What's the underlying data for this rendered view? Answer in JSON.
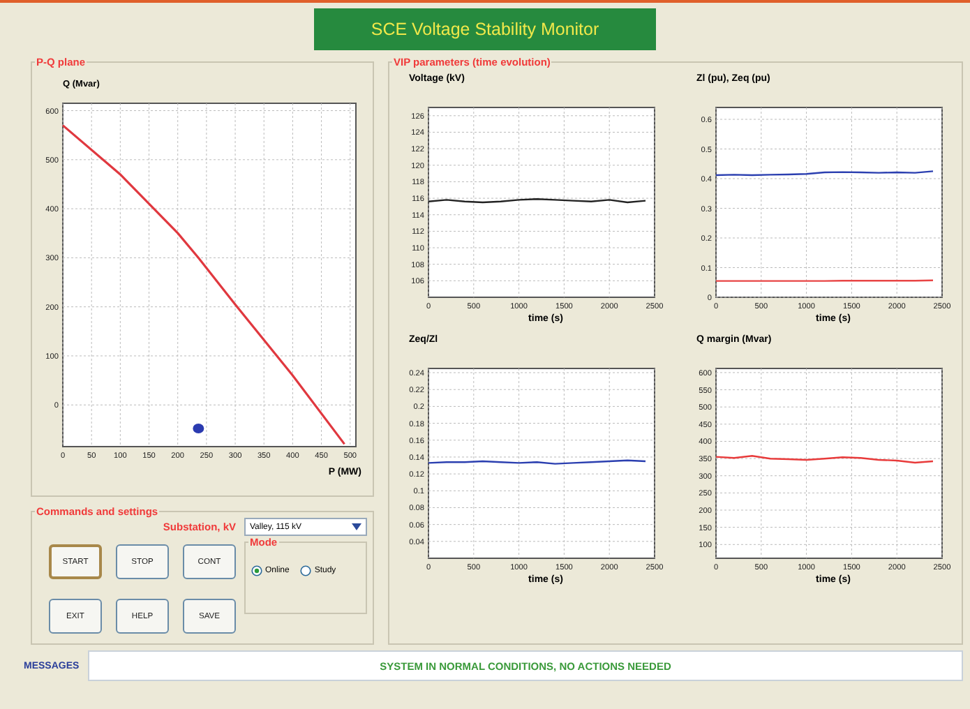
{
  "window": {
    "title": "SCE Voltage Stability Monitor"
  },
  "pq_panel": {
    "title": "P-Q plane",
    "chart_data": {
      "type": "line",
      "grid": true,
      "ylabel": "Q (Mvar)",
      "xlabel": "P (MW)",
      "x": [
        0,
        100,
        200,
        236,
        300,
        400,
        490
      ],
      "xlim": [
        0,
        510
      ],
      "ylim": [
        -85,
        615
      ],
      "xticks": [
        0,
        50,
        100,
        150,
        200,
        250,
        300,
        350,
        400,
        450,
        500
      ],
      "yticks": [
        0,
        100,
        200,
        300,
        400,
        500,
        600
      ],
      "series": [
        {
          "color": "#e0383f",
          "values": [
            570,
            470,
            350,
            300,
            205,
            60,
            -80
          ]
        },
        {
          "color": "#2b3bb0",
          "marker": "o",
          "values": [
            null,
            null,
            null,
            -48,
            null,
            null,
            null
          ]
        }
      ]
    }
  },
  "vip_panel": {
    "title": "VIP parameters (time evolution)",
    "charts": [
      {
        "chart_data": {
          "type": "line",
          "grid": true,
          "title": "Voltage (kV)",
          "xlabel": "time (s)",
          "x": [
            0,
            200,
            400,
            600,
            800,
            1000,
            1200,
            1400,
            1600,
            1800,
            2000,
            2200,
            2400
          ],
          "xlim": [
            0,
            2500
          ],
          "ylim": [
            104,
            127
          ],
          "xticks": [
            0,
            500,
            1000,
            1500,
            2000,
            2500
          ],
          "yticks": [
            106,
            108,
            110,
            112,
            114,
            116,
            118,
            120,
            122,
            124,
            126
          ],
          "series": [
            {
              "color": "#222222",
              "values": [
                115.6,
                115.8,
                115.6,
                115.5,
                115.6,
                115.8,
                115.9,
                115.8,
                115.7,
                115.6,
                115.8,
                115.5,
                115.7
              ]
            }
          ]
        }
      },
      {
        "chart_data": {
          "type": "line",
          "grid": true,
          "title": "Zl (pu), Zeq (pu)",
          "xlabel": "time (s)",
          "x": [
            0,
            200,
            400,
            600,
            800,
            1000,
            1200,
            1400,
            1600,
            1800,
            2000,
            2200,
            2400
          ],
          "xlim": [
            0,
            2500
          ],
          "ylim": [
            0,
            0.64
          ],
          "xticks": [
            0,
            500,
            1000,
            1500,
            2000,
            2500
          ],
          "yticks": [
            0,
            0.1,
            0.2,
            0.3,
            0.4,
            0.5,
            0.6
          ],
          "series": [
            {
              "color": "#2b3fb0",
              "values": [
                0.412,
                0.413,
                0.412,
                0.413,
                0.414,
                0.416,
                0.421,
                0.422,
                0.421,
                0.42,
                0.421,
                0.42,
                0.425
              ]
            },
            {
              "color": "#e84545",
              "values": [
                0.055,
                0.055,
                0.055,
                0.055,
                0.055,
                0.055,
                0.055,
                0.056,
                0.056,
                0.056,
                0.056,
                0.056,
                0.057
              ]
            }
          ]
        }
      },
      {
        "chart_data": {
          "type": "line",
          "grid": true,
          "title": "Zeq/Zl",
          "xlabel": "time (s)",
          "x": [
            0,
            200,
            400,
            600,
            800,
            1000,
            1200,
            1400,
            1600,
            1800,
            2000,
            2200,
            2400
          ],
          "xlim": [
            0,
            2500
          ],
          "ylim": [
            0.02,
            0.245
          ],
          "xticks": [
            0,
            500,
            1000,
            1500,
            2000,
            2500
          ],
          "yticks": [
            0.04,
            0.06,
            0.08,
            0.1,
            0.12,
            0.14,
            0.16,
            0.18,
            0.2,
            0.22,
            0.24
          ],
          "series": [
            {
              "color": "#2b3fb0",
              "values": [
                0.133,
                0.134,
                0.134,
                0.135,
                0.134,
                0.133,
                0.134,
                0.132,
                0.133,
                0.134,
                0.135,
                0.136,
                0.135
              ]
            }
          ]
        }
      },
      {
        "chart_data": {
          "type": "line",
          "grid": true,
          "title": "Q margin (Mvar)",
          "xlabel": "time (s)",
          "x": [
            0,
            200,
            400,
            600,
            800,
            1000,
            1200,
            1400,
            1600,
            1800,
            2000,
            2200,
            2400
          ],
          "xlim": [
            0,
            2500
          ],
          "ylim": [
            60,
            612
          ],
          "xticks": [
            0,
            500,
            1000,
            1500,
            2000,
            2500
          ],
          "yticks": [
            100,
            150,
            200,
            250,
            300,
            350,
            400,
            450,
            500,
            550,
            600
          ],
          "series": [
            {
              "color": "#e83a3a",
              "values": [
                355,
                352,
                358,
                350,
                348,
                346,
                350,
                354,
                352,
                346,
                344,
                338,
                342
              ]
            }
          ]
        }
      }
    ]
  },
  "commands_panel": {
    "title": "Commands and settings",
    "substation_label": "Substation, kV",
    "substation_value": "Valley, 115 kV",
    "buttons": [
      {
        "label": "START",
        "focused": true
      },
      {
        "label": "STOP",
        "focused": false
      },
      {
        "label": "CONT",
        "focused": false
      },
      {
        "label": "EXIT",
        "focused": false
      },
      {
        "label": "HELP",
        "focused": false
      },
      {
        "label": "SAVE",
        "focused": false
      }
    ],
    "mode": {
      "title": "Mode",
      "options": [
        {
          "label": "Online",
          "selected": true
        },
        {
          "label": "Study",
          "selected": false
        }
      ]
    }
  },
  "messages": {
    "label": "MESSAGES",
    "text": "SYSTEM IN NORMAL CONDITIONS, NO ACTIONS NEEDED"
  }
}
